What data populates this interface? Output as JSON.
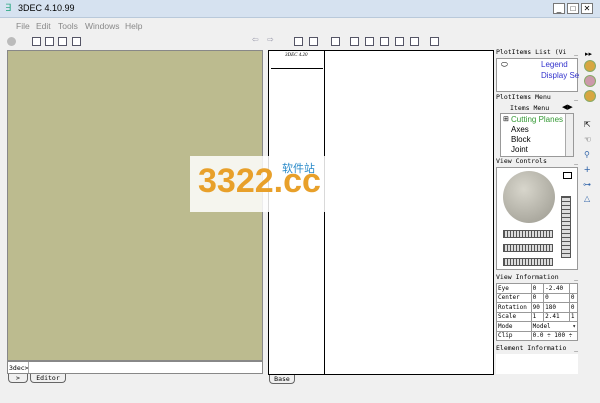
{
  "window": {
    "title": "3DEC 4.10.99",
    "min": "_",
    "max": "□",
    "close": "✕"
  },
  "menu": [
    "File",
    "Edit",
    "Tools",
    "Windows",
    "Help"
  ],
  "console": {
    "prompt": "3dec>",
    "input": "",
    "tabs": [
      ">",
      "Editor"
    ]
  },
  "view": {
    "tabs": [
      "Base"
    ],
    "thumb_title": "3DEC 4.20"
  },
  "plot_items_list": {
    "title": "PlotItems List (Vi",
    "min": "_",
    "items": [
      "Legend",
      "Display Se"
    ]
  },
  "plot_items_menu": {
    "title": "PlotItems Menu",
    "min": "_",
    "tab": "Items Menu",
    "items": [
      "Cutting Planes",
      "Axes",
      "Block",
      "Joint"
    ]
  },
  "view_controls": {
    "title": "View Controls",
    "min": "_"
  },
  "view_info": {
    "title": "View Information",
    "min": "_",
    "rows": [
      {
        "label": "Eye",
        "values": [
          "0",
          "-2.40",
          ""
        ]
      },
      {
        "label": "Center",
        "values": [
          "0",
          "0",
          "0"
        ]
      },
      {
        "label": "Rotation",
        "values": [
          "90",
          "180",
          "0"
        ]
      },
      {
        "label": "Scale",
        "values": [
          "1",
          "2.41",
          "1"
        ]
      },
      {
        "label": "Mode",
        "values": [
          "Model"
        ]
      },
      {
        "label": "Clip",
        "values": [
          "0.0",
          "100"
        ]
      }
    ]
  },
  "element_info": {
    "title": "Element Informatio",
    "min": "_"
  },
  "watermark": {
    "text": "3322.cc",
    "sub": "软件站"
  }
}
